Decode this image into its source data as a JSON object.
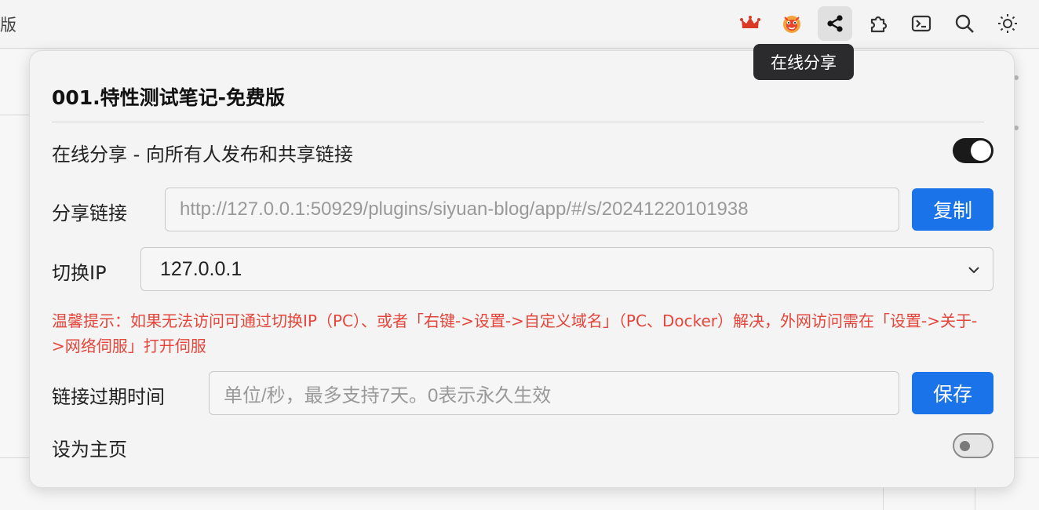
{
  "window": {
    "title_fragment": "版"
  },
  "toolbar": {
    "icons": [
      "crown-icon",
      "lion-dance-icon",
      "share-icon",
      "plugin-icon",
      "terminal-icon",
      "search-icon",
      "sun-icon"
    ],
    "active": "share-icon",
    "tooltip": "在线分享"
  },
  "dialog": {
    "title": "001.特性测试笔记-免费版",
    "share_toggle_label": "在线分享 - 向所有人发布和共享链接",
    "share_toggle_on": true,
    "share_link_label": "分享链接",
    "share_link_value": "http://127.0.0.1:50929/plugins/siyuan-blog/app/#/s/20241220101938",
    "copy_button": "复制",
    "switch_ip_label": "切换IP",
    "switch_ip_value": "127.0.0.1",
    "hint": "温馨提示：如果无法访问可通过切换IP（PC）、或者「右键->设置->自定义域名」（PC、Docker）解决，外网访问需在「设置->关于->网络伺服」打开伺服",
    "expire_label": "链接过期时间",
    "expire_placeholder": "单位/秒，最多支持7天。0表示永久生效",
    "save_button": "保存",
    "homepage_label": "设为主页",
    "homepage_toggle_on": false
  },
  "colors": {
    "accent": "#1a73e8",
    "hint": "#e5453a",
    "toggle_on": "#1a1a1a"
  }
}
